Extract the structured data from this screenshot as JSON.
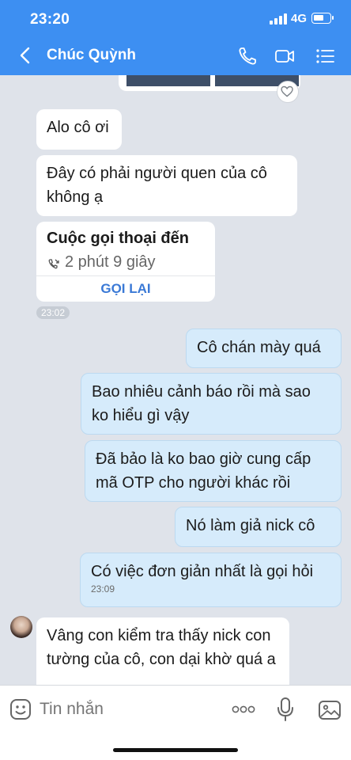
{
  "status_bar": {
    "time": "23:20",
    "network": "4G"
  },
  "header": {
    "contact_name": "Chúc Quỳnh"
  },
  "messages": {
    "m1": "Alo cô ơi",
    "m2": "Đây có phải người quen của cô không ạ",
    "call": {
      "title": "Cuộc gọi thoại đến",
      "duration": "2 phút 9 giây",
      "action": "GỌI LẠI"
    },
    "stamp1": "23:02",
    "o1": "Cô chán mày quá",
    "o2": "Bao nhiêu cảnh báo rồi mà sao ko hiểu gì vậy",
    "o3": "Đã bảo là ko bao giờ cung cấp mã OTP cho người khác rồi",
    "o4": "Nó làm giả nick cô",
    "o5": "Có việc đơn giản nhất là gọi hỏi",
    "o5_time": "23:09",
    "m3": "Vâng con kiểm tra thấy nick con tường của cô, con dại khờ quá a"
  },
  "composer": {
    "placeholder": "Tin nhắn"
  },
  "colors": {
    "header": "#3d8ff2",
    "outgoing": "#d6ebfb",
    "incoming": "#ffffff",
    "accent": "#3a79d6"
  },
  "icons": [
    "back-icon",
    "phone-icon",
    "video-icon",
    "menu-icon",
    "heart-icon",
    "phone-incoming-icon",
    "sticker-icon",
    "more-icon",
    "mic-icon",
    "image-icon"
  ]
}
